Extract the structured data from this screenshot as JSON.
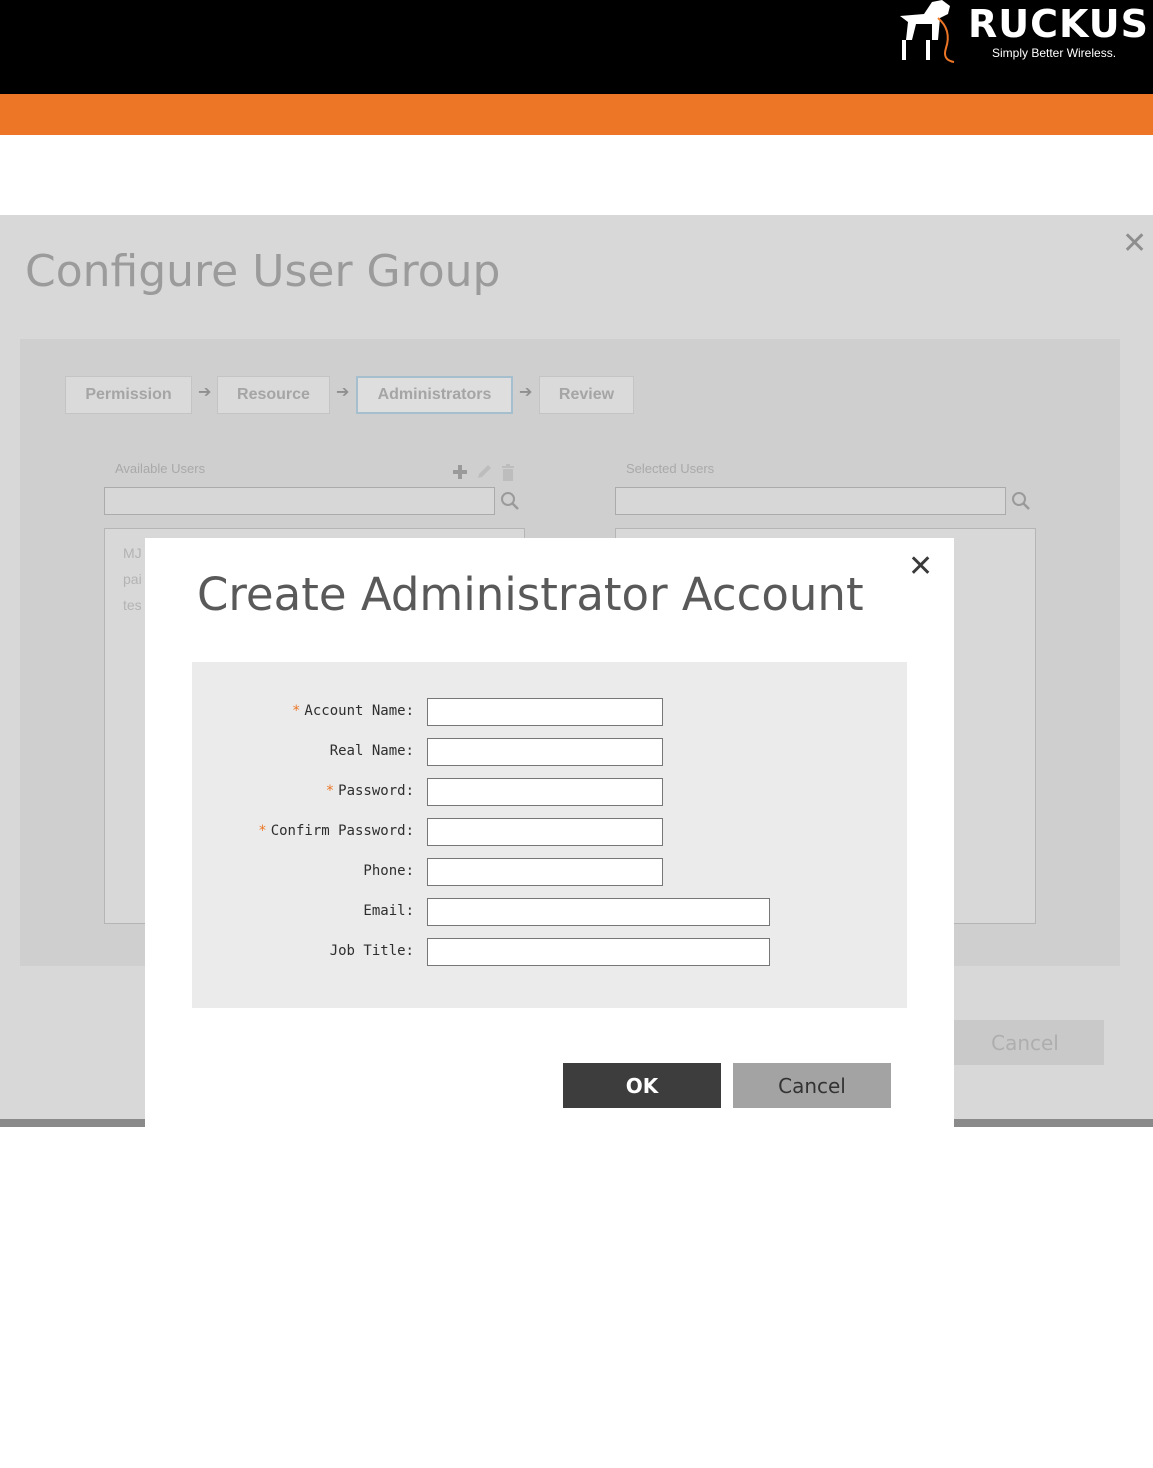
{
  "header": {
    "brand": "RUCKUS",
    "tagline": "Simply Better Wireless.",
    "colors": {
      "bar": "#000000",
      "accent": "#ec7626"
    }
  },
  "background_dialog": {
    "title": "Configure User Group",
    "close_icon": "close-icon",
    "steps": [
      "Permission",
      "Resource",
      "Administrators",
      "Review"
    ],
    "active_step": "Administrators",
    "available_users_label": "Available Users",
    "selected_users_label": "Selected Users",
    "available_users": [
      "MJ",
      "pai",
      "tes"
    ],
    "cancel_label": "Cancel"
  },
  "modal": {
    "title": "Create Administrator Account",
    "close_icon": "close-icon",
    "fields": [
      {
        "label": "Account Name:",
        "required": true,
        "value": ""
      },
      {
        "label": "Real Name:",
        "required": false,
        "value": ""
      },
      {
        "label": "Password:",
        "required": true,
        "value": ""
      },
      {
        "label": "Confirm Password:",
        "required": true,
        "value": ""
      },
      {
        "label": "Phone:",
        "required": false,
        "value": ""
      },
      {
        "label": "Email:",
        "required": false,
        "value": ""
      },
      {
        "label": "Job Title:",
        "required": false,
        "value": ""
      }
    ],
    "required_marker": "*",
    "ok_label": "OK",
    "cancel_label": "Cancel"
  }
}
